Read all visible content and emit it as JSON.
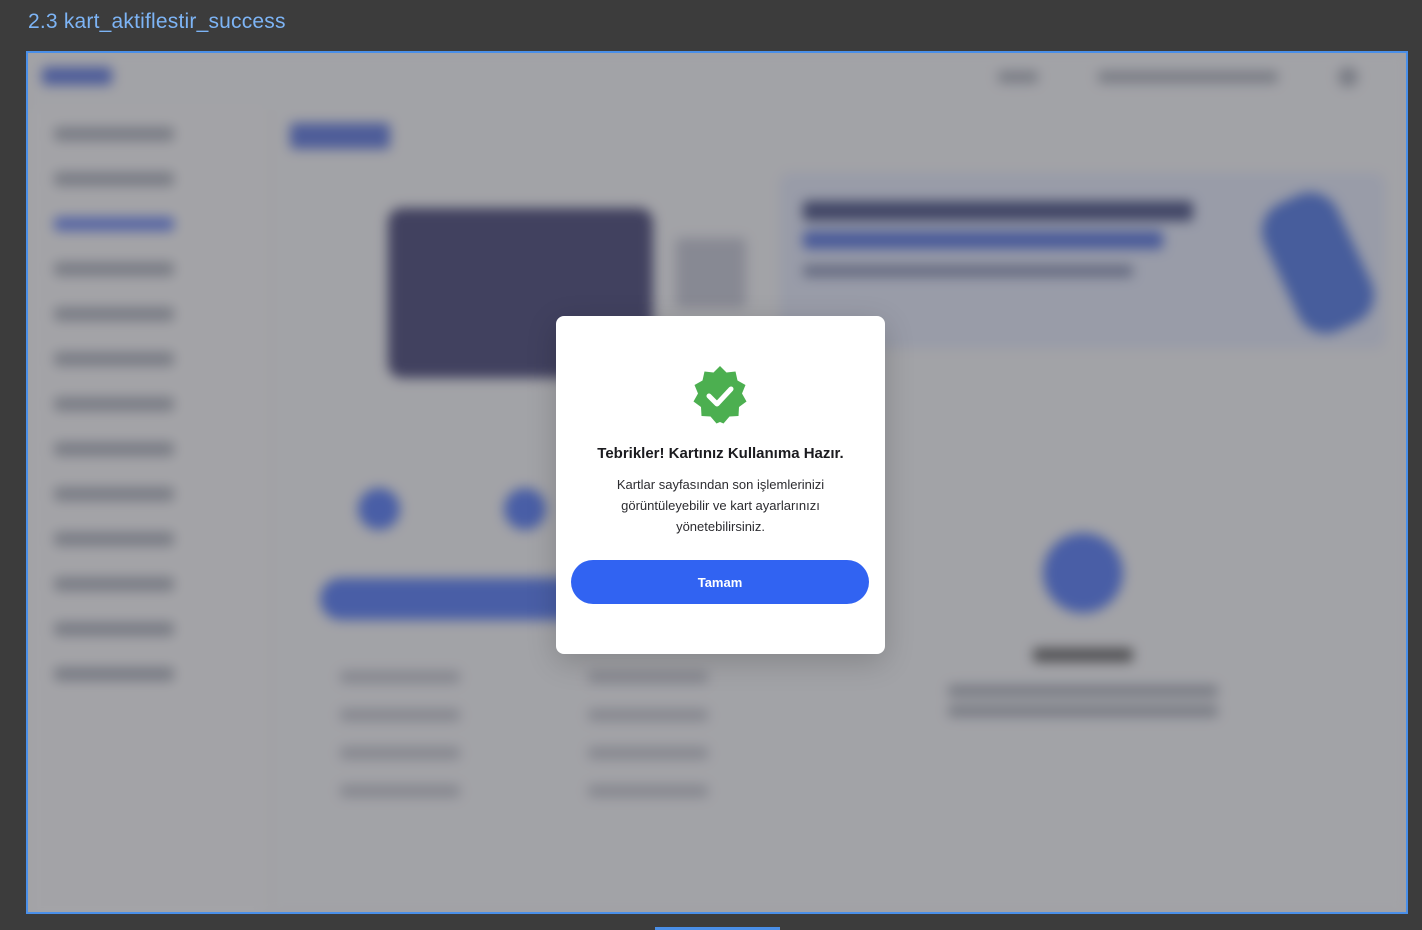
{
  "frame": {
    "title": "2.3 kart_aktiflestir_success"
  },
  "modal": {
    "icon": "verified-check-badge-icon",
    "title": "Tebrikler! Kartınız Kullanıma Hazır.",
    "message": "Kartlar sayfasından son işlemlerinizi görüntüleyebilir ve kart ayarlarınızı yönetebilirsiniz.",
    "confirm_label": "Tamam"
  },
  "colors": {
    "accent": "#3163f2",
    "success": "#4caf50",
    "frame_border": "#4a8fe8",
    "frame_title": "#7db4f5"
  }
}
